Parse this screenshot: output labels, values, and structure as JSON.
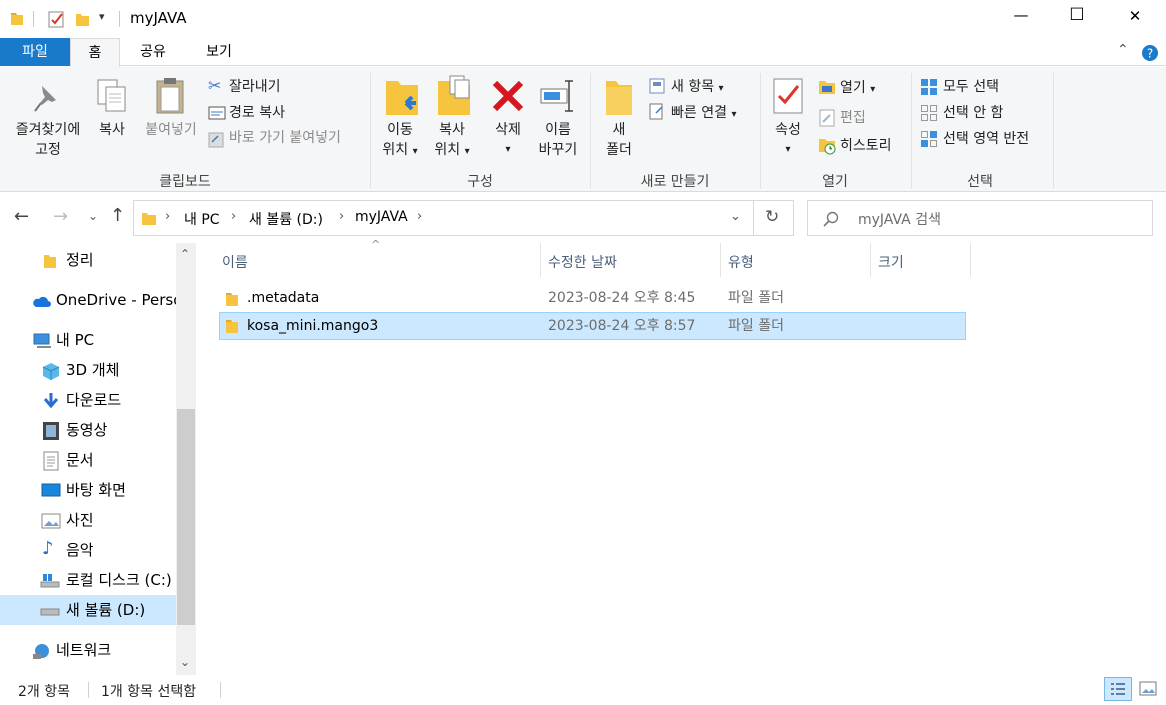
{
  "window": {
    "title": "myJAVA",
    "controls": {
      "minimize": "—",
      "maximize": "☐",
      "close": "✕"
    }
  },
  "ribbon_tabs": [
    {
      "label": "파일",
      "active": false,
      "primary": true
    },
    {
      "label": "홈",
      "active": true
    },
    {
      "label": "공유",
      "active": false
    },
    {
      "label": "보기",
      "active": false
    }
  ],
  "ribbon": {
    "clipboard": {
      "pin_line1": "즐겨찾기에",
      "pin_line2": "고정",
      "copy": "복사",
      "paste": "붙여넣기",
      "cut": "잘라내기",
      "copy_path": "경로 복사",
      "paste_shortcut": "바로 가기 붙여넣기",
      "group": "클립보드"
    },
    "organize": {
      "move_line1": "이동",
      "move_line2": "위치",
      "copyto_line1": "복사",
      "copyto_line2": "위치",
      "delete": "삭제",
      "rename_line1": "이름",
      "rename_line2": "바꾸기",
      "group": "구성"
    },
    "new": {
      "newfolder_line1": "새",
      "newfolder_line2": "폴더",
      "new_item": "새 항목",
      "easy_access": "빠른 연결",
      "group": "새로 만들기"
    },
    "open": {
      "properties": "속성",
      "open": "열기",
      "edit": "편집",
      "history": "히스토리",
      "group": "열기"
    },
    "select": {
      "select_all": "모두 선택",
      "select_none": "선택 안 함",
      "invert": "선택 영역 반전",
      "group": "선택"
    }
  },
  "address": {
    "crumbs": [
      "내 PC",
      "새 볼륨 (D:)",
      "myJAVA"
    ],
    "search_placeholder": "myJAVA 검색"
  },
  "nav": [
    {
      "label": "정리",
      "icon": "folder-icon"
    },
    {
      "label": "OneDrive - Personal",
      "icon": "cloud-icon"
    },
    {
      "label": "내 PC",
      "icon": "pc-icon"
    },
    {
      "label": "3D 개체",
      "icon": "cube-icon"
    },
    {
      "label": "다운로드",
      "icon": "download-icon"
    },
    {
      "label": "동영상",
      "icon": "video-icon"
    },
    {
      "label": "문서",
      "icon": "document-icon"
    },
    {
      "label": "바탕 화면",
      "icon": "desktop-icon"
    },
    {
      "label": "사진",
      "icon": "picture-icon"
    },
    {
      "label": "음악",
      "icon": "music-icon"
    },
    {
      "label": "로컬 디스크 (C:)",
      "icon": "drive-icon"
    },
    {
      "label": "새 볼륨 (D:)",
      "icon": "drive-icon",
      "selected": true
    },
    {
      "label": "네트워크",
      "icon": "network-icon"
    }
  ],
  "columns": {
    "name": "이름",
    "modified": "수정한 날짜",
    "type": "유형",
    "size": "크기"
  },
  "files": [
    {
      "name": ".metadata",
      "modified": "2023-08-24 오후 8:45",
      "type": "파일 폴더",
      "size": ""
    },
    {
      "name": "kosa_mini.mango3",
      "modified": "2023-08-24 오후 8:57",
      "type": "파일 폴더",
      "size": "",
      "selected": true
    }
  ],
  "status": {
    "count": "2개 항목",
    "selected": "1개 항목 선택함"
  },
  "colors": {
    "accent": "#1979ca",
    "selection": "#cce8ff",
    "selection_border": "#99d1ff",
    "folder": "#f6c53d"
  }
}
